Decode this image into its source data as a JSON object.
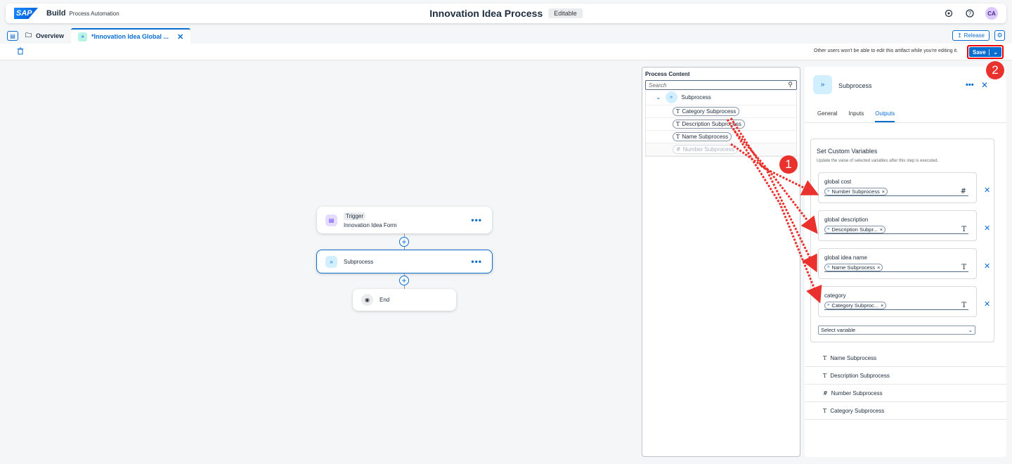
{
  "shell": {
    "logo": "SAP",
    "product": "Build",
    "product_sub": "Process Automation",
    "title": "Innovation Idea Process",
    "status_badge": "Editable",
    "avatar_initials": "CA"
  },
  "tabs": [
    {
      "label": "Overview"
    },
    {
      "label": "*Innovation Idea Global ..."
    }
  ],
  "release_label": "Release",
  "toolbar": {
    "note": "Other users won't be able to edit this artifact while you're editing it.",
    "save_label": "Save"
  },
  "canvas": {
    "trigger_tag": "Trigger",
    "trigger_name": "Innovation Idea Form",
    "subprocess_name": "Subprocess",
    "end_name": "End"
  },
  "process_content": {
    "title": "Process Content",
    "search_placeholder": "Search",
    "parent": "Subprocess",
    "items": [
      {
        "label": "Category Subprocess",
        "type": "T",
        "disabled": false
      },
      {
        "label": "Description Subprocess",
        "type": "T",
        "disabled": false
      },
      {
        "label": "Name Subprocess",
        "type": "T",
        "disabled": false
      },
      {
        "label": "Number Subprocess",
        "type": "#",
        "disabled": true
      }
    ]
  },
  "properties": {
    "title": "Subprocess",
    "tabs": [
      "General",
      "Inputs",
      "Outputs"
    ],
    "active_tab": "Outputs",
    "custom_vars_title": "Set Custom Variables",
    "custom_vars_desc": "Update the value of selected variables after this step is executed.",
    "variables": [
      {
        "label": "global cost",
        "token": "Number Subprocess",
        "type": "#"
      },
      {
        "label": "global description",
        "token": "Description Subpr...",
        "type": "T"
      },
      {
        "label": "global idea name",
        "token": "Name Subprocess",
        "type": "T"
      },
      {
        "label": "category",
        "token": "Category Subproc...",
        "type": "T"
      }
    ],
    "select_placeholder": "Select variable",
    "outputs": [
      {
        "label": "Name Subprocess",
        "type": "T"
      },
      {
        "label": "Description Subprocess",
        "type": "T"
      },
      {
        "label": "Number Subprocess",
        "type": "#"
      },
      {
        "label": "Category Subprocess",
        "type": "T"
      }
    ]
  },
  "annotations": {
    "one": "1",
    "two": "2"
  },
  "colors": {
    "accent": "#0a6ed1",
    "annotation": "#e9322d"
  }
}
